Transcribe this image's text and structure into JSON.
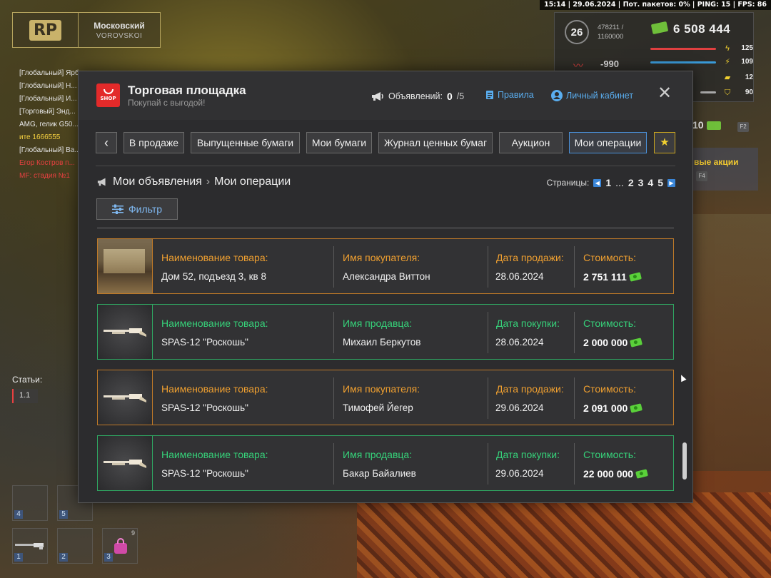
{
  "topbar": {
    "text": "15:14 | 29.06.2024 | Пот. пакетов: 0% | PING: 15 | FPS: 86"
  },
  "logo": {
    "mark": "RP",
    "server_name": "Московский",
    "server_sub": "VOROVSKOI"
  },
  "chat": {
    "lines": [
      "[Глобальный] Ярб...",
      "[Глобальный] Н...",
      "[Глобальный] И...",
      "[Торговый] Энд...",
      " AMG, гелик G50...",
      "ите 1666555",
      "[Глобальный] Ва...",
      "Егор Костров п...",
      "MF: стадия №1"
    ]
  },
  "articles": {
    "label": "Статьи:",
    "value": "1.1"
  },
  "inventory": {
    "slots": [
      {
        "num": "4",
        "count": ""
      },
      {
        "num": "5",
        "count": ""
      },
      {
        "num": "1",
        "count": ""
      },
      {
        "num": "2",
        "count": ""
      },
      {
        "num": "3",
        "count": "9"
      }
    ]
  },
  "hud": {
    "level": "26",
    "exp": "478211 /",
    "exp_max": "1160000",
    "money": "6 508 444",
    "reputation": "-990",
    "stats": [
      "125",
      "109",
      "12",
      "90"
    ],
    "stat_left": "0",
    "side_money": "10",
    "key_f2": "F2",
    "key_f4": "F4",
    "promo": "вые акции"
  },
  "window": {
    "title": "Торговая площадка",
    "subtitle": "Покупай с выгодой!",
    "shop_logo_text": "SHOP",
    "ads_label": "Объявлений:",
    "ads_count": "0",
    "ads_max": "/5",
    "rules_link": "Правила",
    "cabinet_link": "Личный кабинет",
    "close": "✕"
  },
  "tabs": {
    "back": "‹",
    "items": [
      "В продаже",
      "Выпущенные бумаги",
      "Мои бумаги",
      "Журнал ценных бумаг",
      "Аукцион",
      "Мои операции"
    ],
    "star": "★"
  },
  "breadcrumb": {
    "first": "Мои объявления",
    "sep": "›",
    "current": "Мои операции"
  },
  "pages": {
    "label": "Страницы:",
    "items": [
      "1",
      "...",
      "2",
      "3",
      "4",
      "5"
    ]
  },
  "filter": {
    "label": "Фильтр"
  },
  "operations": [
    {
      "type": "sell",
      "name_label": "Наименование товара:",
      "name": "Дом 52, подъезд 3, кв 8",
      "person_label": "Имя покупателя:",
      "person": "Александра Виттон",
      "date_label": "Дата продажи:",
      "date": "28.06.2024",
      "price_label": "Стоимость:",
      "price": "2 751 111"
    },
    {
      "type": "buy",
      "name_label": "Наименование товара:",
      "name": "SPAS-12 \"Роскошь\"",
      "person_label": "Имя продавца:",
      "person": "Михаил Беркутов",
      "date_label": "Дата покупки:",
      "date": "28.06.2024",
      "price_label": "Стоимость:",
      "price": "2 000 000"
    },
    {
      "type": "sell",
      "name_label": "Наименование товара:",
      "name": "SPAS-12 \"Роскошь\"",
      "person_label": "Имя покупателя:",
      "person": "Тимофей Йегер",
      "date_label": "Дата продажи:",
      "date": "29.06.2024",
      "price_label": "Стоимость:",
      "price": "2 091 000"
    },
    {
      "type": "buy",
      "name_label": "Наименование товара:",
      "name": "SPAS-12 \"Роскошь\"",
      "person_label": "Имя продавца:",
      "person": "Бакар Байалиев",
      "date_label": "Дата покупки:",
      "date": "29.06.2024",
      "price_label": "Стоимость:",
      "price": "22 000 000"
    }
  ]
}
